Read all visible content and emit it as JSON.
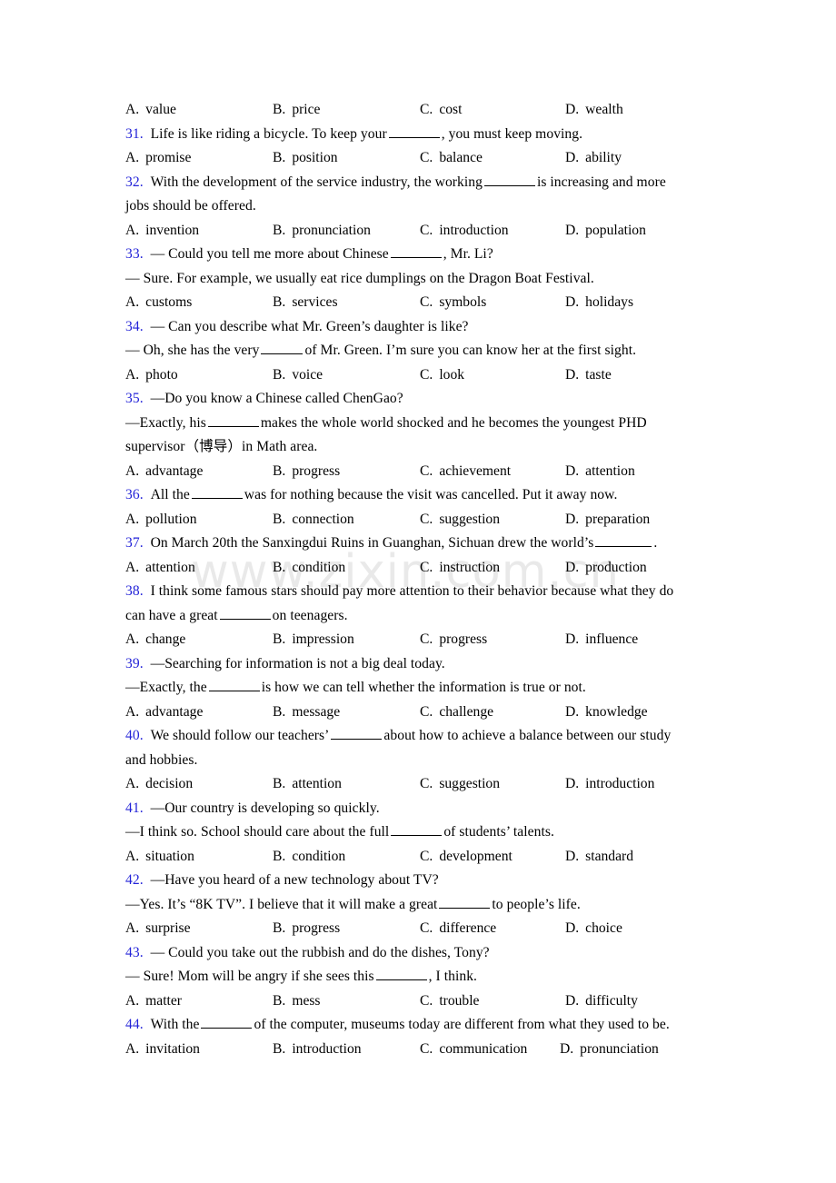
{
  "watermark": {
    "text": "www.zixin.com.cn",
    "color": "#e9e9e9"
  },
  "colors": {
    "question_number": "#2323d8",
    "body_text": "#000000"
  },
  "exercise": {
    "type": "multiple-choice-vocabulary",
    "option_labels": [
      "A.",
      "B.",
      "C.",
      "D."
    ],
    "orphan_options_top": {
      "note": "options belonging to question 30 which is cut off above",
      "options": [
        "value",
        "price",
        "cost",
        "wealth"
      ]
    },
    "questions": [
      {
        "number": "31.",
        "stem_lines": [
          {
            "before": "Life is like riding a bicycle. To keep your",
            "blank": true,
            "after": ", you must keep moving."
          }
        ],
        "options": [
          "promise",
          "position",
          "balance",
          "ability"
        ]
      },
      {
        "number": "32.",
        "stem_lines": [
          {
            "before": "With the development of the service industry, the working",
            "blank": true,
            "after": "is increasing and more"
          },
          {
            "before": "jobs should be offered.",
            "blank": false,
            "after": ""
          }
        ],
        "options": [
          "invention",
          "pronunciation",
          "introduction",
          "population"
        ]
      },
      {
        "number": "33.",
        "stem_lines": [
          {
            "before": "— Could you tell me more about Chinese",
            "blank": true,
            "after": ", Mr. Li?"
          },
          {
            "before": "— Sure. For example, we usually eat rice dumplings on the Dragon Boat Festival.",
            "blank": false,
            "after": ""
          }
        ],
        "options": [
          "customs",
          "services",
          "symbols",
          "holidays"
        ]
      },
      {
        "number": "34.",
        "stem_lines": [
          {
            "before": "— Can you describe what Mr. Green’s daughter is like?",
            "blank": false,
            "after": ""
          },
          {
            "before": "— Oh, she has the very",
            "blank": true,
            "after": "of Mr. Green. I’m sure you can know her at the first sight."
          }
        ],
        "options": [
          "photo",
          "voice",
          "look",
          "taste"
        ]
      },
      {
        "number": "35.",
        "stem_lines": [
          {
            "before": "—Do you know a Chinese called ChenGao?",
            "blank": false,
            "after": ""
          },
          {
            "before": "—Exactly, his",
            "blank": true,
            "after": "makes the whole world shocked and he becomes the youngest PHD"
          },
          {
            "before": "supervisor（博导）in Math area.",
            "blank": false,
            "after": ""
          }
        ],
        "options": [
          "advantage",
          "progress",
          "achievement",
          "attention"
        ]
      },
      {
        "number": "36.",
        "stem_lines": [
          {
            "before": "All the",
            "blank": true,
            "after": "was for nothing because the visit was cancelled. Put it away now."
          }
        ],
        "options": [
          "pollution",
          "connection",
          "suggestion",
          "preparation"
        ]
      },
      {
        "number": "37.",
        "stem_lines": [
          {
            "before": "On March 20th the Sanxingdui Ruins in Guanghan, Sichuan drew the world’s",
            "blank": true,
            "after": "."
          }
        ],
        "options": [
          "attention",
          "condition",
          "instruction",
          "production"
        ]
      },
      {
        "number": "38.",
        "stem_lines": [
          {
            "before": "I think some famous stars should pay more attention to their behavior because what they do",
            "blank": false,
            "after": ""
          },
          {
            "before": "can have a great",
            "blank": true,
            "after": "on teenagers."
          }
        ],
        "options": [
          "change",
          "impression",
          "progress",
          "influence"
        ]
      },
      {
        "number": "39.",
        "stem_lines": [
          {
            "before": "—Searching for information is not a big deal today.",
            "blank": false,
            "after": ""
          },
          {
            "before": "—Exactly, the",
            "blank": true,
            "after": "is how we can tell whether the information is true or not."
          }
        ],
        "options": [
          "advantage",
          "message",
          "challenge",
          "knowledge"
        ]
      },
      {
        "number": "40.",
        "stem_lines": [
          {
            "before": "We should follow our teachers’",
            "blank": true,
            "after": "about how to achieve a balance between our study"
          },
          {
            "before": "and hobbies.",
            "blank": false,
            "after": ""
          }
        ],
        "options": [
          "decision",
          "attention",
          "suggestion",
          "introduction"
        ]
      },
      {
        "number": "41.",
        "stem_lines": [
          {
            "before": "—Our country is developing so quickly.",
            "blank": false,
            "after": ""
          },
          {
            "before": "—I think so. School should care about the full",
            "blank": true,
            "after": "of students’ talents."
          }
        ],
        "options": [
          "situation",
          "condition",
          "development",
          "standard"
        ]
      },
      {
        "number": "42.",
        "stem_lines": [
          {
            "before": "—Have you heard of a new technology about TV?",
            "blank": false,
            "after": ""
          },
          {
            "before": "—Yes. It’s “8K TV”. I believe that it will make a great",
            "blank": true,
            "after": "to people’s life."
          }
        ],
        "options": [
          "surprise",
          "progress",
          "difference",
          "choice"
        ]
      },
      {
        "number": "43.",
        "stem_lines": [
          {
            "before": "— Could you take out the rubbish and do the dishes, Tony?",
            "blank": false,
            "after": ""
          },
          {
            "before": "— Sure! Mom will be angry if she sees this",
            "blank": true,
            "after": ", I think."
          }
        ],
        "options": [
          "matter",
          "mess",
          "trouble",
          "difficulty"
        ]
      },
      {
        "number": "44.",
        "stem_lines": [
          {
            "before": "With the",
            "blank": true,
            "after": "of the computer, museums today are different from what they used to be."
          }
        ],
        "options": [
          "invitation",
          "introduction",
          "communication",
          "pronunciation"
        ]
      }
    ]
  }
}
